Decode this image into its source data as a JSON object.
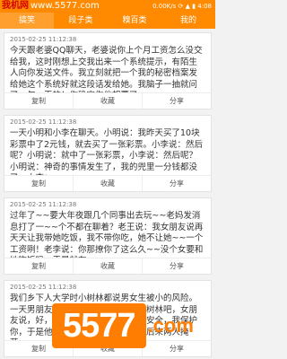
{
  "watermark_top": {
    "label": "我机网",
    "url": "www.5577.com"
  },
  "status_bar": {
    "info": "0.00K/s ⟳ ▲ ▮ 4:08"
  },
  "tabs": [
    {
      "label": "搞笑",
      "active": true
    },
    {
      "label": "段子类",
      "active": false
    },
    {
      "label": "糗百类",
      "active": false
    },
    {
      "label": "我的",
      "active": false
    }
  ],
  "posts": [
    {
      "timestamp": "2015-02-25 11:12:38",
      "text": "今天跟老婆QQ聊天，老婆说你上个月工资怎么没交给我，这时刚想上交我出来一个系统提示，有陌生人向你发送文件。我立刻就把一个我的秘密档案发给她这个系统好就这段话发给她。我脑子一抽就问了一句，干的！你确定你他想要了..."
    },
    {
      "timestamp": "2015-02-25 11:12:38",
      "text": "一天小明和小李在聊天。小明说：我昨天买了10块彩票中了2元钱，就去买了一张彩票。小李说：然后呢？小明说：就中了一张彩票，小李说：然后呢？小明说：神奇的事情发生了，我的兜里一分钱都没了。小李：..."
    },
    {
      "timestamp": "2015-02-25 11:12:38",
      "text": "过年了~~要大年夜跟几个同事出去玩~~老妈发消息打了一~~个不都在聊着？老王说：我女朋友说再天天让我带她吃饭，我不带你吃，她不让她~~一个工资咧！老李说：你那撩你了这么久~~没个女要和她吃饭吗，于是就在~~..."
    },
    {
      "timestamp": "2015-02-25 11:12:38",
      "text": "我们乡下人大学时小树林都说男女生被小的风险。一天男朋友和对女朋友说，咱们去小树林吧，女朋友说，好，小树林危险。男朋友说：安全，我保护你，于是他们两个人就去了小树林，后来两人掩落..."
    }
  ],
  "actions": {
    "copy": "复制",
    "favorite": "收藏",
    "share": "分享"
  },
  "watermark_logo": {
    "text": "5577",
    "suffix": ".com"
  }
}
